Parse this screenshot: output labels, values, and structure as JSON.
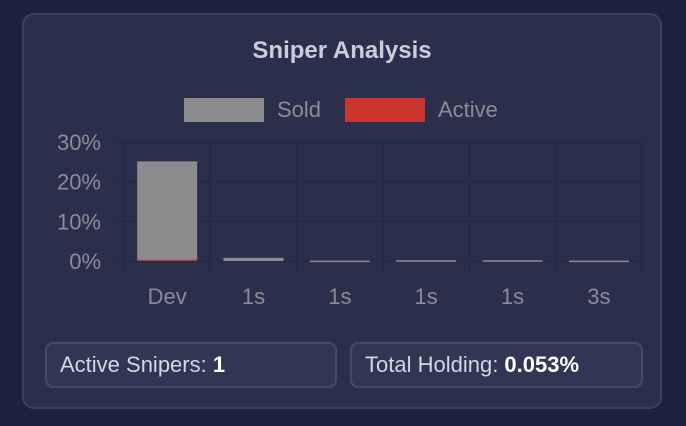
{
  "title": "Sniper Analysis",
  "colors": {
    "sold": "#8c8c8f",
    "active": "#cc3530",
    "grid": "#252a44",
    "axis_text": "#8a8c97",
    "legend_text": "#8a8c97"
  },
  "chart_data": {
    "type": "bar",
    "stacked": true,
    "categories": [
      "Dev",
      "1s",
      "1s",
      "1s",
      "1s",
      "3s"
    ],
    "series": [
      {
        "name": "Sold",
        "values": [
          24.8,
          0.8,
          0.1,
          0.2,
          0.2,
          0.1
        ]
      },
      {
        "name": "Active",
        "values": [
          0.3,
          0.0,
          0.0,
          0.0,
          0.0,
          0.0
        ]
      }
    ],
    "ylim": [
      0,
      30
    ],
    "yticks": [
      0,
      10,
      20,
      30
    ],
    "ytick_labels": [
      "0%",
      "10%",
      "20%",
      "30%"
    ],
    "legend_position": "top",
    "grid": true
  },
  "stats": {
    "active_label": "Active Snipers: ",
    "active_value": "1",
    "holding_label": "Total Holding: ",
    "holding_value": "0.053%"
  }
}
